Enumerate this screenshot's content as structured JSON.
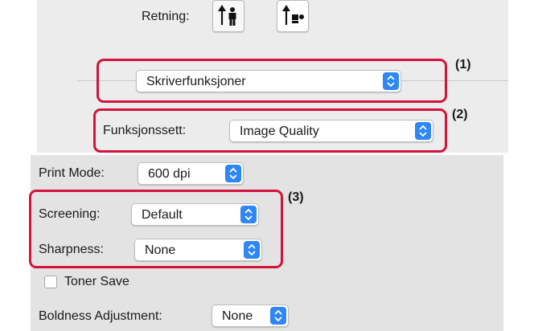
{
  "orientation": {
    "label": "Retning:",
    "options": [
      "portrait-icon",
      "landscape-icon"
    ],
    "selected": "portrait-icon"
  },
  "panel_select": {
    "value": "Skriverfunksjoner"
  },
  "feature_set": {
    "label": "Funksjonssett:",
    "value": "Image Quality"
  },
  "print_mode": {
    "label": "Print Mode:",
    "value": "600 dpi"
  },
  "screening": {
    "label": "Screening:",
    "value": "Default"
  },
  "sharpness": {
    "label": "Sharpness:",
    "value": "None"
  },
  "toner_save": {
    "label": "Toner Save",
    "checked": false
  },
  "boldness": {
    "label": "Boldness Adjustment:",
    "value": "None"
  },
  "callouts": [
    "(1)",
    "(2)",
    "(3)"
  ],
  "colors": {
    "accent": "#2f87f5",
    "callout": "#d2143a"
  }
}
